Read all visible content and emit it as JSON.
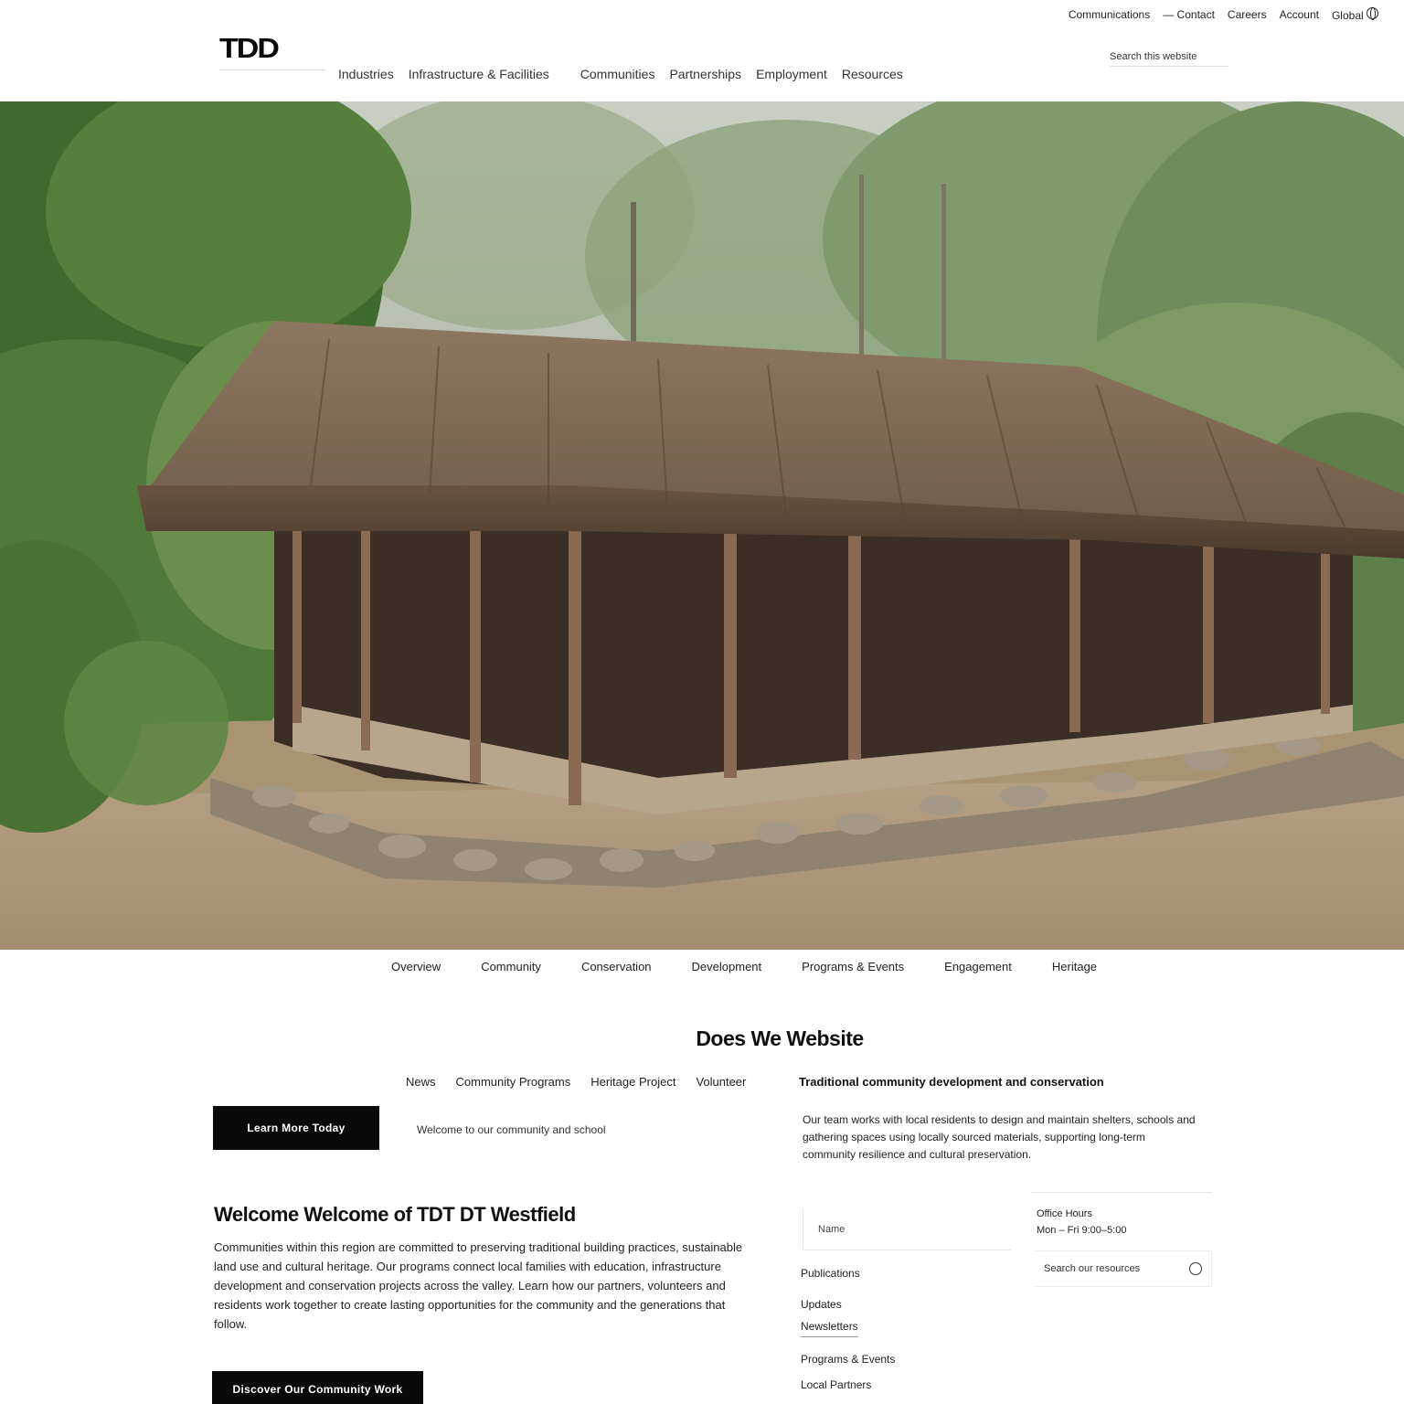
{
  "header": {
    "logo": "TDD",
    "utility_nav": [
      "Communications",
      "— Contact",
      "Careers",
      "Account",
      "Global"
    ],
    "search_placeholder": "Search this website",
    "main_nav": [
      "Industries",
      "Infrastructure & Facilities",
      "Communities",
      "Partnerships",
      "Employment",
      "Resources"
    ]
  },
  "hero": {
    "alt": "Thatched-roof hut in a forest clearing"
  },
  "section_nav": [
    "Overview",
    "Community",
    "Conservation",
    "Development",
    "Programs & Events",
    "Engagement",
    "Heritage"
  ],
  "content": {
    "section_title": "Does We Website",
    "sub_tabs": [
      "News",
      "Community Programs",
      "Heritage Project",
      "Volunteer"
    ],
    "cta_primary": "Learn More Today",
    "cta_caption": "Welcome to our community and school",
    "about_title": "Welcome Welcome of TDT DT Westfield",
    "about_body": "Communities within this region are committed to preserving traditional building practices, sustainable land use and cultural heritage. Our programs connect local families with education, infrastructure development and conservation projects across the valley. Learn how our partners, volunteers and residents work together to create lasting opportunities for the community and the generations that follow.",
    "cta_secondary": "Discover Our Community Work",
    "right_heading": "Traditional community development and conservation",
    "right_body": "Our team works with local residents to design and maintain shelters, schools and gathering spaces using locally sourced materials, supporting long-term community resilience and cultural preservation.",
    "form_input_value": "Name",
    "info_card_lines": [
      "Office Hours",
      "Mon – Fri 9:00–5:00"
    ],
    "search_placeholder": "Search our resources",
    "links": [
      "Publications",
      "Updates",
      "Newsletters",
      "Programs & Events",
      "Local Partners"
    ]
  }
}
